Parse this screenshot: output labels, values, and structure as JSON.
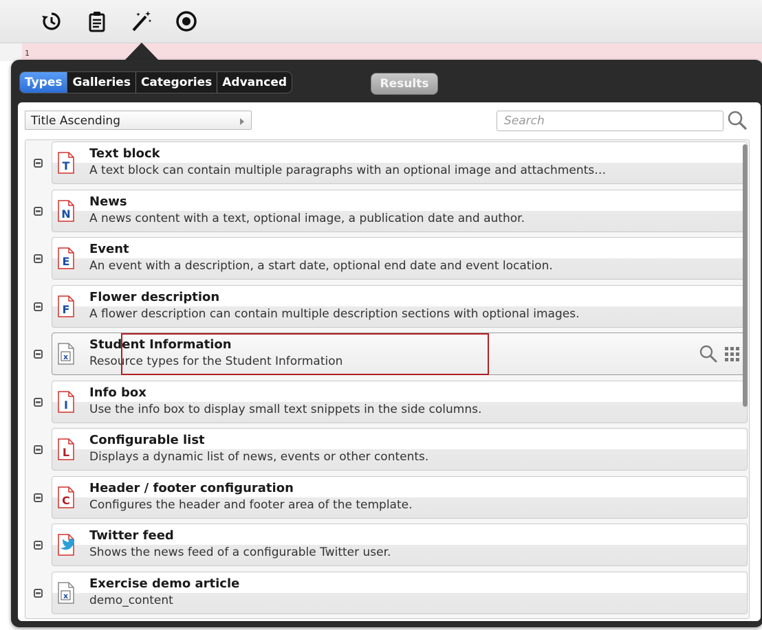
{
  "toolbar": {
    "icons": [
      "history-icon",
      "clipboard-icon",
      "magic-wand-icon",
      "target-icon"
    ]
  },
  "editor": {
    "line_number": "1"
  },
  "tabs": [
    {
      "label": "Types",
      "active": true
    },
    {
      "label": "Galleries",
      "active": false
    },
    {
      "label": "Categories",
      "active": false
    },
    {
      "label": "Advanced",
      "active": false
    }
  ],
  "results_label": "Results",
  "sort": {
    "selected": "Title Ascending"
  },
  "search": {
    "placeholder": "Search"
  },
  "items": [
    {
      "title": "Text block",
      "description": "A text block can contain multiple paragraphs with an optional image and attachments…",
      "letter": "T",
      "color": "#1a4fa3"
    },
    {
      "title": "News",
      "description": "A news content with a text, optional image, a publication date and author.",
      "letter": "N",
      "color": "#1a4fa3"
    },
    {
      "title": "Event",
      "description": "An event with a description, a start date, optional end date and event location.",
      "letter": "E",
      "color": "#1a4fa3"
    },
    {
      "title": "Flower description",
      "description": "A flower description can contain multiple description sections with optional images.",
      "letter": "F",
      "color": "#1a4fa3"
    },
    {
      "title": "Student Information",
      "description": "Resource types for the Student Information",
      "letter": "x",
      "color": "#1a4fa3"
    },
    {
      "title": "Info box",
      "description": "Use the info box to display small text snippets in the side columns.",
      "letter": "I",
      "color": "#1a4fa3"
    },
    {
      "title": "Configurable list",
      "description": "Displays a dynamic list of news, events or other contents.",
      "letter": "L",
      "color": "#b02025"
    },
    {
      "title": "Header / footer configuration",
      "description": "Configures the header and footer area of the template.",
      "letter": "C",
      "color": "#b02025"
    },
    {
      "title": "Twitter feed",
      "description": "Shows the news feed of a configurable Twitter user.",
      "letter": "",
      "color": "#2a9fd8"
    },
    {
      "title": "Exercise demo article",
      "description": "demo_content",
      "letter": "x",
      "color": "#1a4fa3"
    }
  ],
  "colors": {
    "accent_tab": "#2b6fd8",
    "dialog_bg": "#2b2b2b",
    "highlight_border": "#b02025",
    "doc_icon_red": "#d0312d"
  }
}
